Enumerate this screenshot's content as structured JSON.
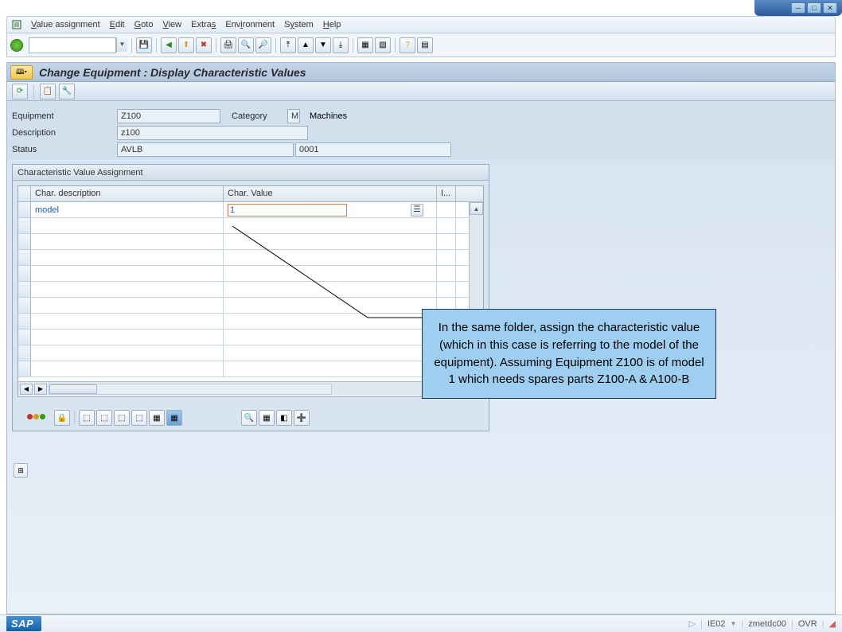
{
  "menu": {
    "items": [
      "Value assignment",
      "Edit",
      "Goto",
      "View",
      "Extras",
      "Environment",
      "System",
      "Help"
    ],
    "underlinePos": [
      0,
      0,
      0,
      0,
      5,
      3,
      1,
      0
    ]
  },
  "screen_title": "Change Equipment : Display Characteristic Values",
  "form": {
    "equipment_label": "Equipment",
    "equipment": "Z100",
    "category_label": "Category",
    "category": "M",
    "category_text": "Machines",
    "description_label": "Description",
    "description": "z100",
    "status_label": "Status",
    "status": "AVLB",
    "status_code": "0001"
  },
  "panel": {
    "title": "Characteristic Value Assignment",
    "headers": {
      "desc": "Char. description",
      "val": "Char. Value",
      "i": "I..."
    },
    "rows": [
      {
        "desc": "model",
        "val": "1"
      }
    ]
  },
  "callout": "In the same folder, assign the characteristic value (which in this case is referring to the model of the equipment). Assuming Equipment Z100 is of model 1 which needs spares parts Z100-A & A100-B",
  "status": {
    "tcode": "IE02",
    "system": "zmetdc00",
    "mode": "OVR"
  }
}
